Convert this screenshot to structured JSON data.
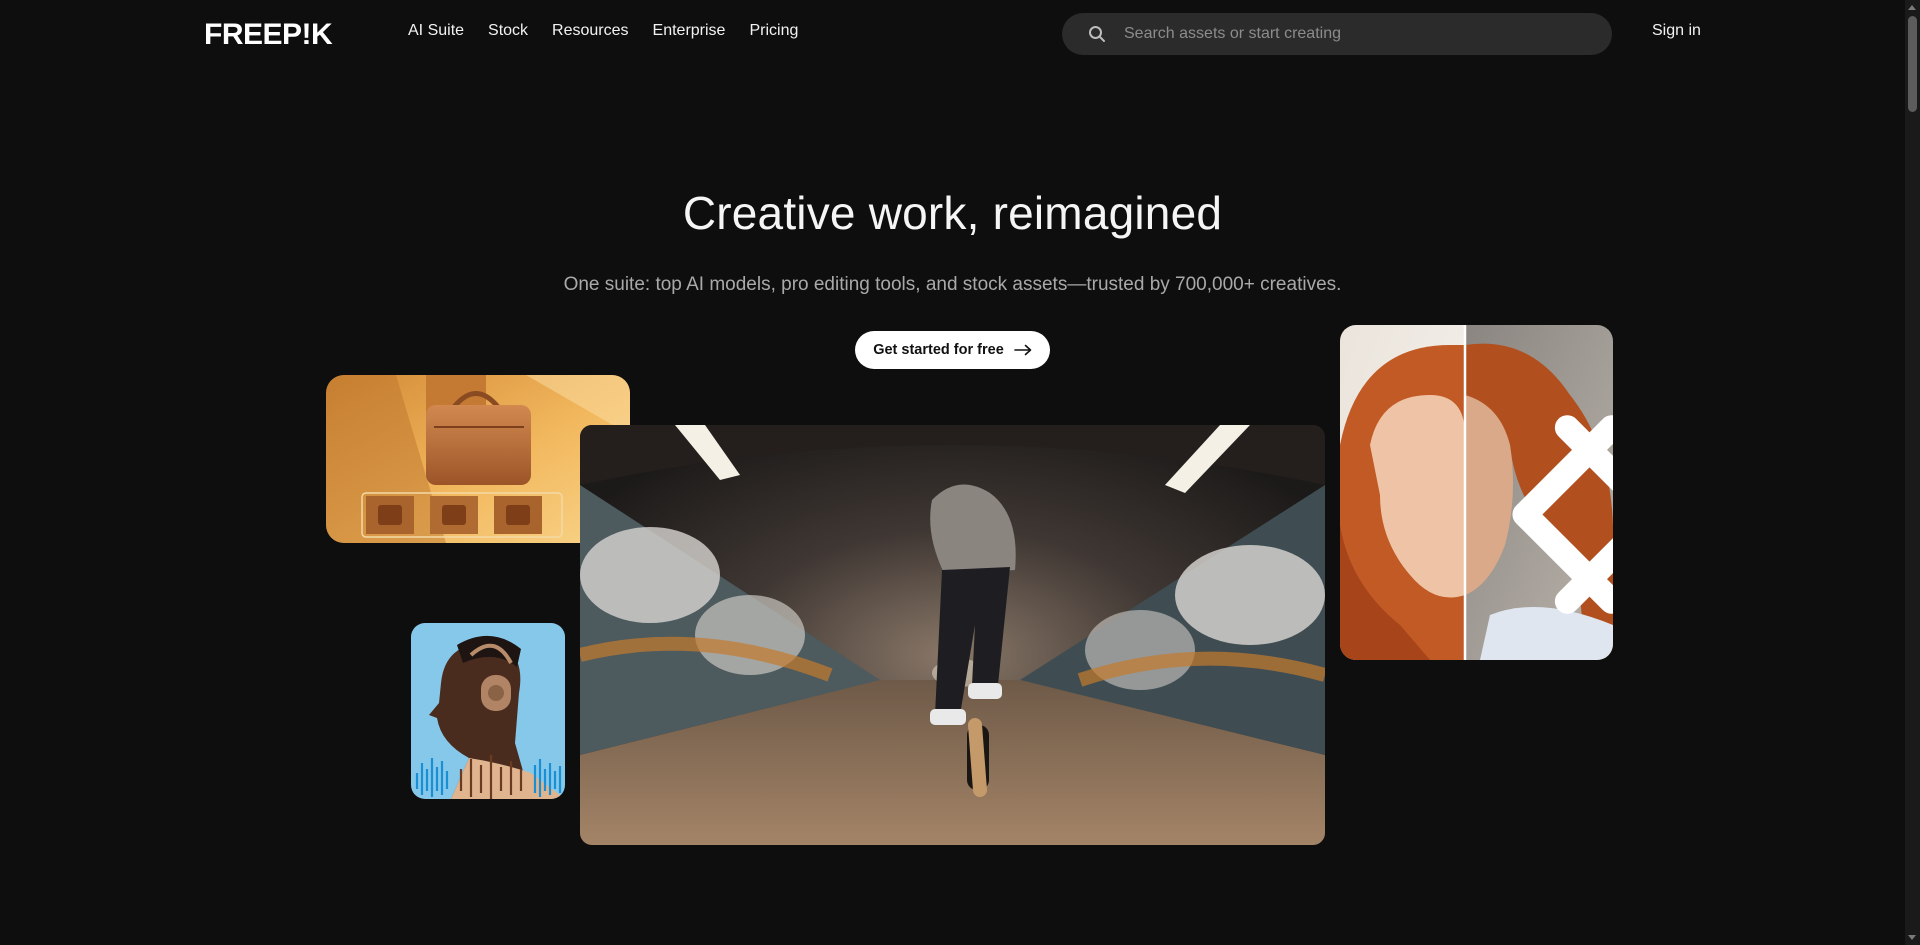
{
  "header": {
    "logo_text": "FREEP!K",
    "nav": [
      {
        "label": "AI Suite"
      },
      {
        "label": "Stock"
      },
      {
        "label": "Resources"
      },
      {
        "label": "Enterprise"
      },
      {
        "label": "Pricing"
      }
    ],
    "search": {
      "placeholder": "Search assets or start creating"
    },
    "sign_in": "Sign in"
  },
  "hero": {
    "title": "Creative work, reimagined",
    "subtitle": "One suite: top AI models, pro editing tools, and stock assets—trusted by 700,000+ creatives.",
    "cta_label": "Get started for free"
  },
  "colors": {
    "background": "#0e0e0e",
    "search_bg": "#2b2b2b",
    "cta_bg": "#ffffff",
    "subtitle": "#a9a9a9"
  },
  "icons": {
    "search": "search-icon",
    "cta": "arrow-right-icon",
    "compare_prev": "chevron-left-icon",
    "compare_next": "chevron-right-icon"
  }
}
